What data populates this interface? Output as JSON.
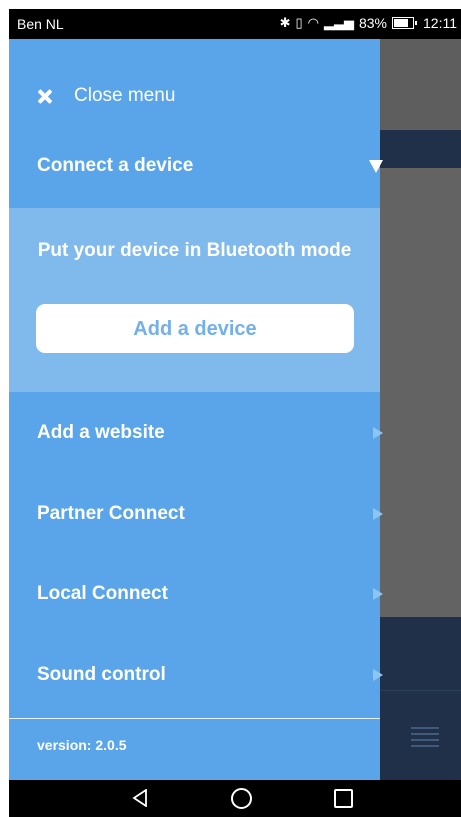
{
  "status_bar": {
    "carrier": "Ben NL",
    "battery": "83%",
    "time": "12:11"
  },
  "drawer": {
    "close_label": "Close menu",
    "connect_label": "Connect a device",
    "bluetooth_message": "Put your device in Bluetooth mode",
    "add_device_label": "Add a device",
    "items": [
      {
        "label": "Add a website"
      },
      {
        "label": "Partner Connect"
      },
      {
        "label": "Local Connect"
      },
      {
        "label": "Sound control"
      }
    ],
    "version": "version: 2.0.5"
  },
  "colors": {
    "drawer": "#5aa5e9",
    "panel": "#80b9ec",
    "background_dark": "#1f3048"
  }
}
